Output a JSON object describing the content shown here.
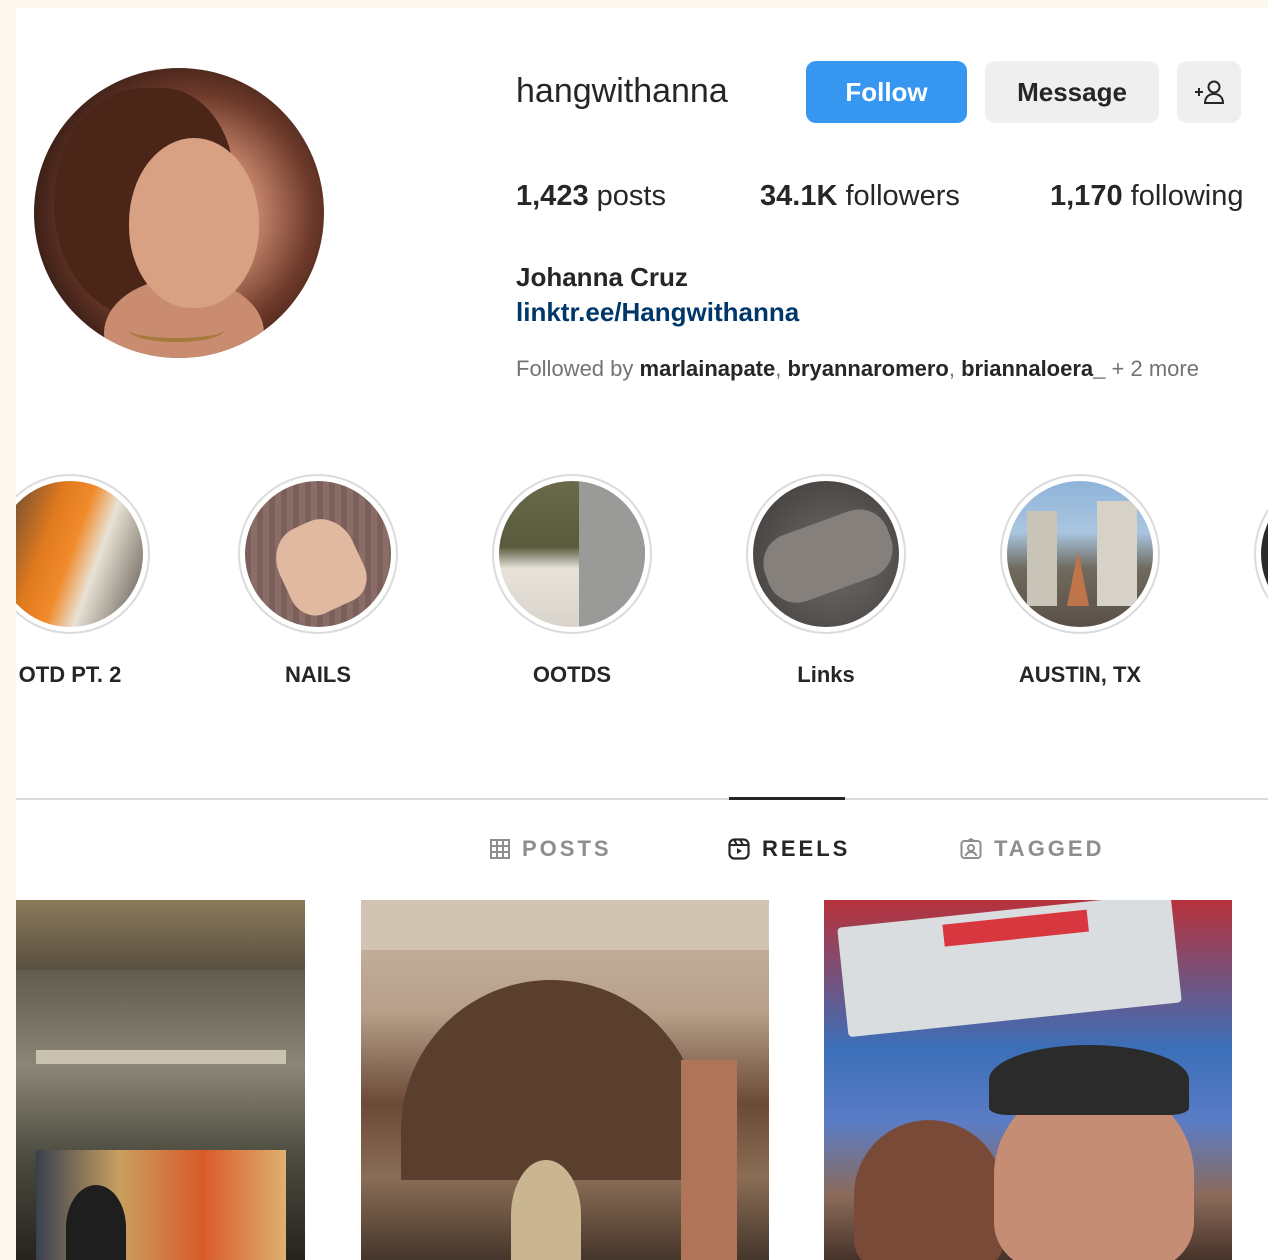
{
  "profile": {
    "username": "hangwithanna",
    "full_name": "Johanna Cruz",
    "link": "linktr.ee/Hangwithanna",
    "follow_label": "Follow",
    "message_label": "Message",
    "add_user_icon": "+ᴬ",
    "stats": {
      "posts_count": "1,423",
      "posts_label": "posts",
      "followers_count": "34.1K",
      "followers_label": "followers",
      "following_count": "1,170",
      "following_label": "following"
    },
    "followed_by": {
      "prefix": "Followed by",
      "users": [
        "marlainapate",
        "bryannaromero",
        "briannaloera_"
      ],
      "suffix": "+ 2 more"
    }
  },
  "highlights": [
    {
      "label": "OTD PT. 2"
    },
    {
      "label": "NAILS"
    },
    {
      "label": "OOTDS"
    },
    {
      "label": "Links"
    },
    {
      "label": "AUSTIN, TX"
    }
  ],
  "tabs": [
    {
      "label": "POSTS",
      "icon": "grid-icon",
      "active": false
    },
    {
      "label": "REELS",
      "icon": "reels-icon",
      "active": true
    },
    {
      "label": "TAGGED",
      "icon": "tagged-icon",
      "active": false
    }
  ],
  "colors": {
    "accent": "#3797f0",
    "link": "#00376b",
    "muted": "#737373"
  }
}
